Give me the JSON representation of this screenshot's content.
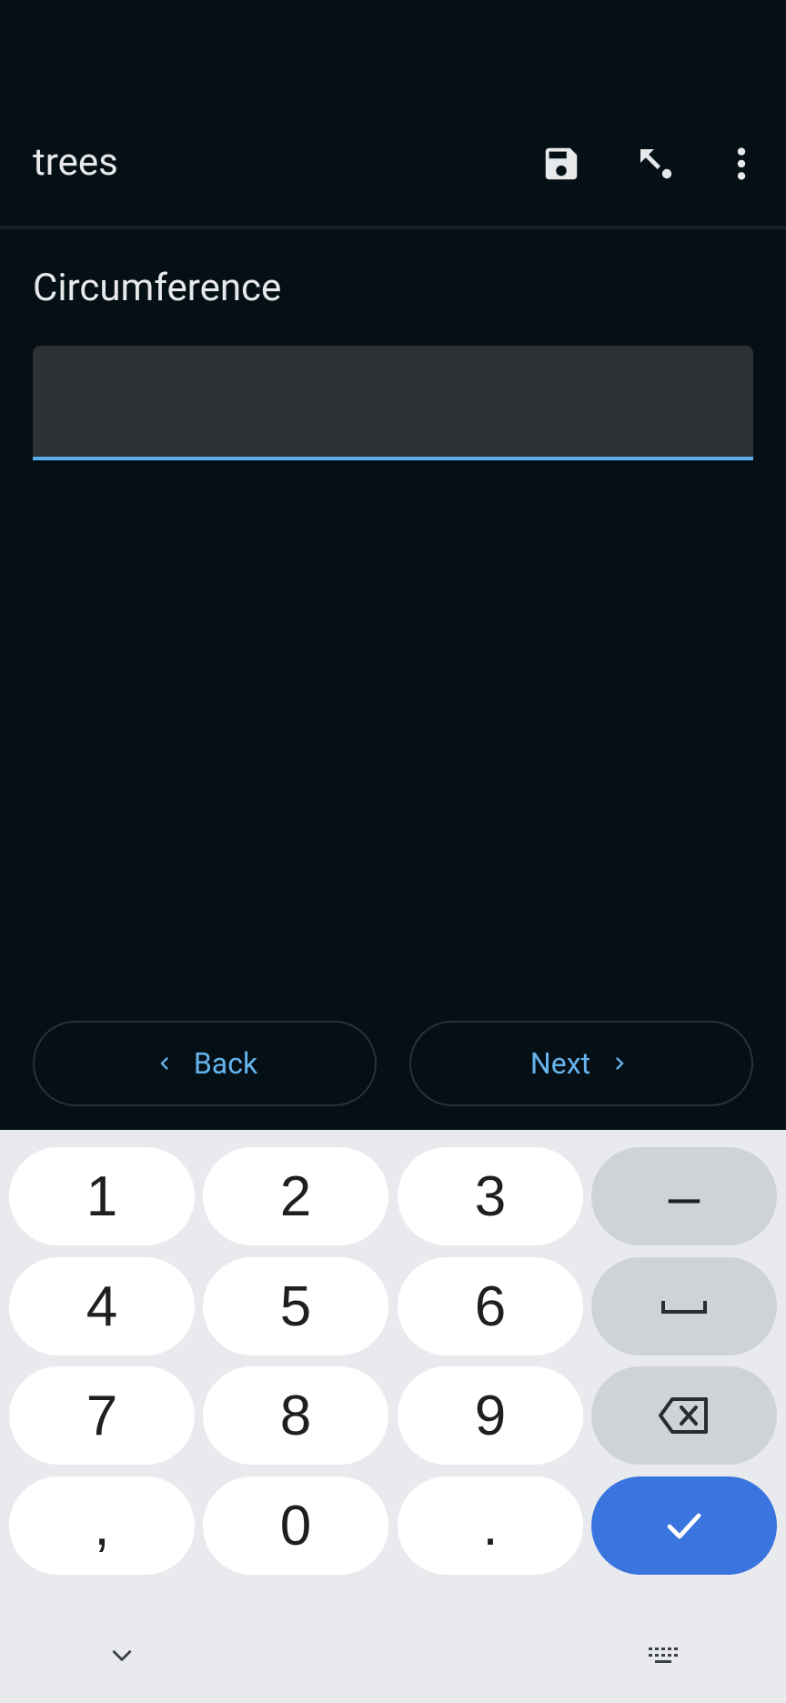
{
  "app_bar": {
    "title": "trees",
    "icons": [
      "save-icon",
      "jump-icon",
      "more-vert-icon"
    ]
  },
  "question": {
    "label": "Circumference",
    "value": "",
    "placeholder": ""
  },
  "navigation": {
    "back_label": "Back",
    "next_label": "Next"
  },
  "keyboard": {
    "keys": {
      "k1": "1",
      "k2": "2",
      "k3": "3",
      "dash": "–",
      "k4": "4",
      "k5": "5",
      "k6": "6",
      "k7": "7",
      "k8": "8",
      "k9": "9",
      "comma": ",",
      "k0": "0",
      "period": "."
    },
    "icons": [
      "space-icon",
      "backspace-icon",
      "check-icon",
      "chevron-down-icon",
      "keyboard-icon"
    ]
  },
  "colors": {
    "background": "#050f16",
    "accent": "#5aaeea",
    "field_background": "#2d3134",
    "keyboard_background": "#e8eaed",
    "done_key": "#3a74de"
  }
}
